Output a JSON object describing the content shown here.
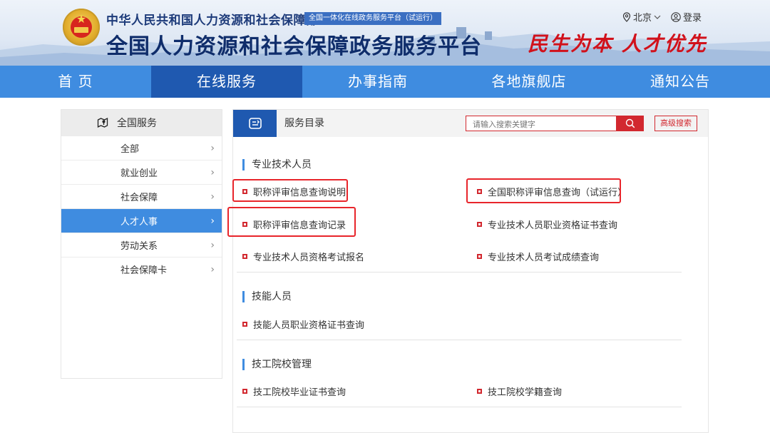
{
  "header": {
    "ministry": "中华人民共和国人力资源和社会保障部",
    "badge": "全国一体化在线政务服务平台（试运行）",
    "platform": "全国人力资源和社会保障政务服务平台",
    "slogan": "民生为本 人才优先",
    "location": "北京",
    "login": "登录"
  },
  "nav": [
    "首 页",
    "在线服务",
    "办事指南",
    "各地旗舰店",
    "通知公告"
  ],
  "sidebar": {
    "title": "全国服务",
    "items": [
      "全部",
      "就业创业",
      "社会保障",
      "人才人事",
      "劳动关系",
      "社会保障卡"
    ],
    "active_index": 3
  },
  "content": {
    "title": "服务目录",
    "search_placeholder": "请输入搜索关键字",
    "advanced": "高级搜索",
    "sections": [
      {
        "title": "专业技术人员",
        "items": [
          "职称评审信息查询说明",
          "全国职称评审信息查询（试运行）",
          "职称评审信息查询记录",
          "专业技术人员职业资格证书查询",
          "专业技术人员资格考试报名",
          "专业技术人员考试成绩查询"
        ]
      },
      {
        "title": "技能人员",
        "items": [
          "技能人员职业资格证书查询"
        ]
      },
      {
        "title": "技工院校管理",
        "items": [
          "技工院校毕业证书查询",
          "技工院校学籍查询"
        ]
      }
    ]
  },
  "colors": {
    "nav_blue": "#3f8ce0",
    "nav_active": "#1f59b0",
    "accent_red": "#d2282f",
    "highlight_red": "#e8252b"
  }
}
